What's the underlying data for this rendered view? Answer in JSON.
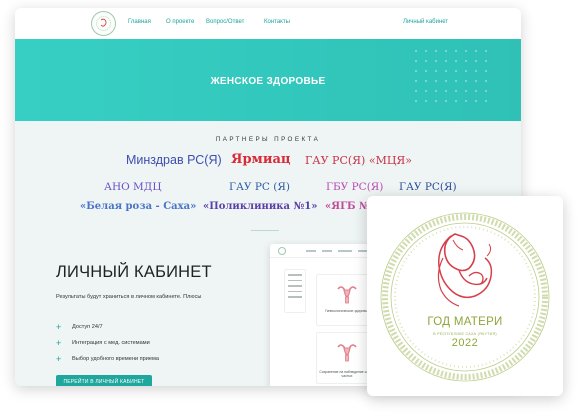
{
  "nav": {
    "links": [
      "Главная",
      "О проекте",
      "Вопрос/Ответ",
      "Контакты"
    ],
    "cabinet": "Личный кабинет"
  },
  "hero": {
    "title": "ЖЕНСКОЕ ЗДОРОВЬЕ"
  },
  "partners": {
    "title": "ПАРТНЕРЫ ПРОЕКТА",
    "items": [
      "Минздрав РС(Я)",
      "Ярмиац",
      "ГАУ РС(Я) «МЦЯ»",
      "АНО МДЦ",
      "ГАУ РС (Я)",
      "ГБУ РС(Я)",
      "ГАУ РС(Я)",
      "«Белая роза - Саха»",
      "«Поликлиника №1»",
      "«ЯГБ №"
    ]
  },
  "cabinet": {
    "title": "ЛИЧНЫЙ КАБИНЕТ",
    "description": "Результаты будут храниться в личном кабинете. Плюсы",
    "features": [
      "Доступ 24/7",
      "Интеграция с мед. системами",
      "Выбор удобного времени приема"
    ],
    "button": "ПЕРЕЙТИ В ЛИЧНЫЙ КАБИНЕТ"
  },
  "mockup": {
    "tiles": [
      "Гинекологическое здоровье",
      "Сохранение на наблюдение самых частых"
    ]
  },
  "emblem": {
    "title": "ГОД МАТЕРИ",
    "subtitle": "В РЕСПУБЛИКЕ САХА (ЯКУТИЯ)",
    "year": "2022"
  },
  "colors": {
    "accent": "#1fa79e",
    "hero": "#33c9be",
    "emblem_green": "#8ea63a",
    "emblem_red": "#d6404b"
  }
}
